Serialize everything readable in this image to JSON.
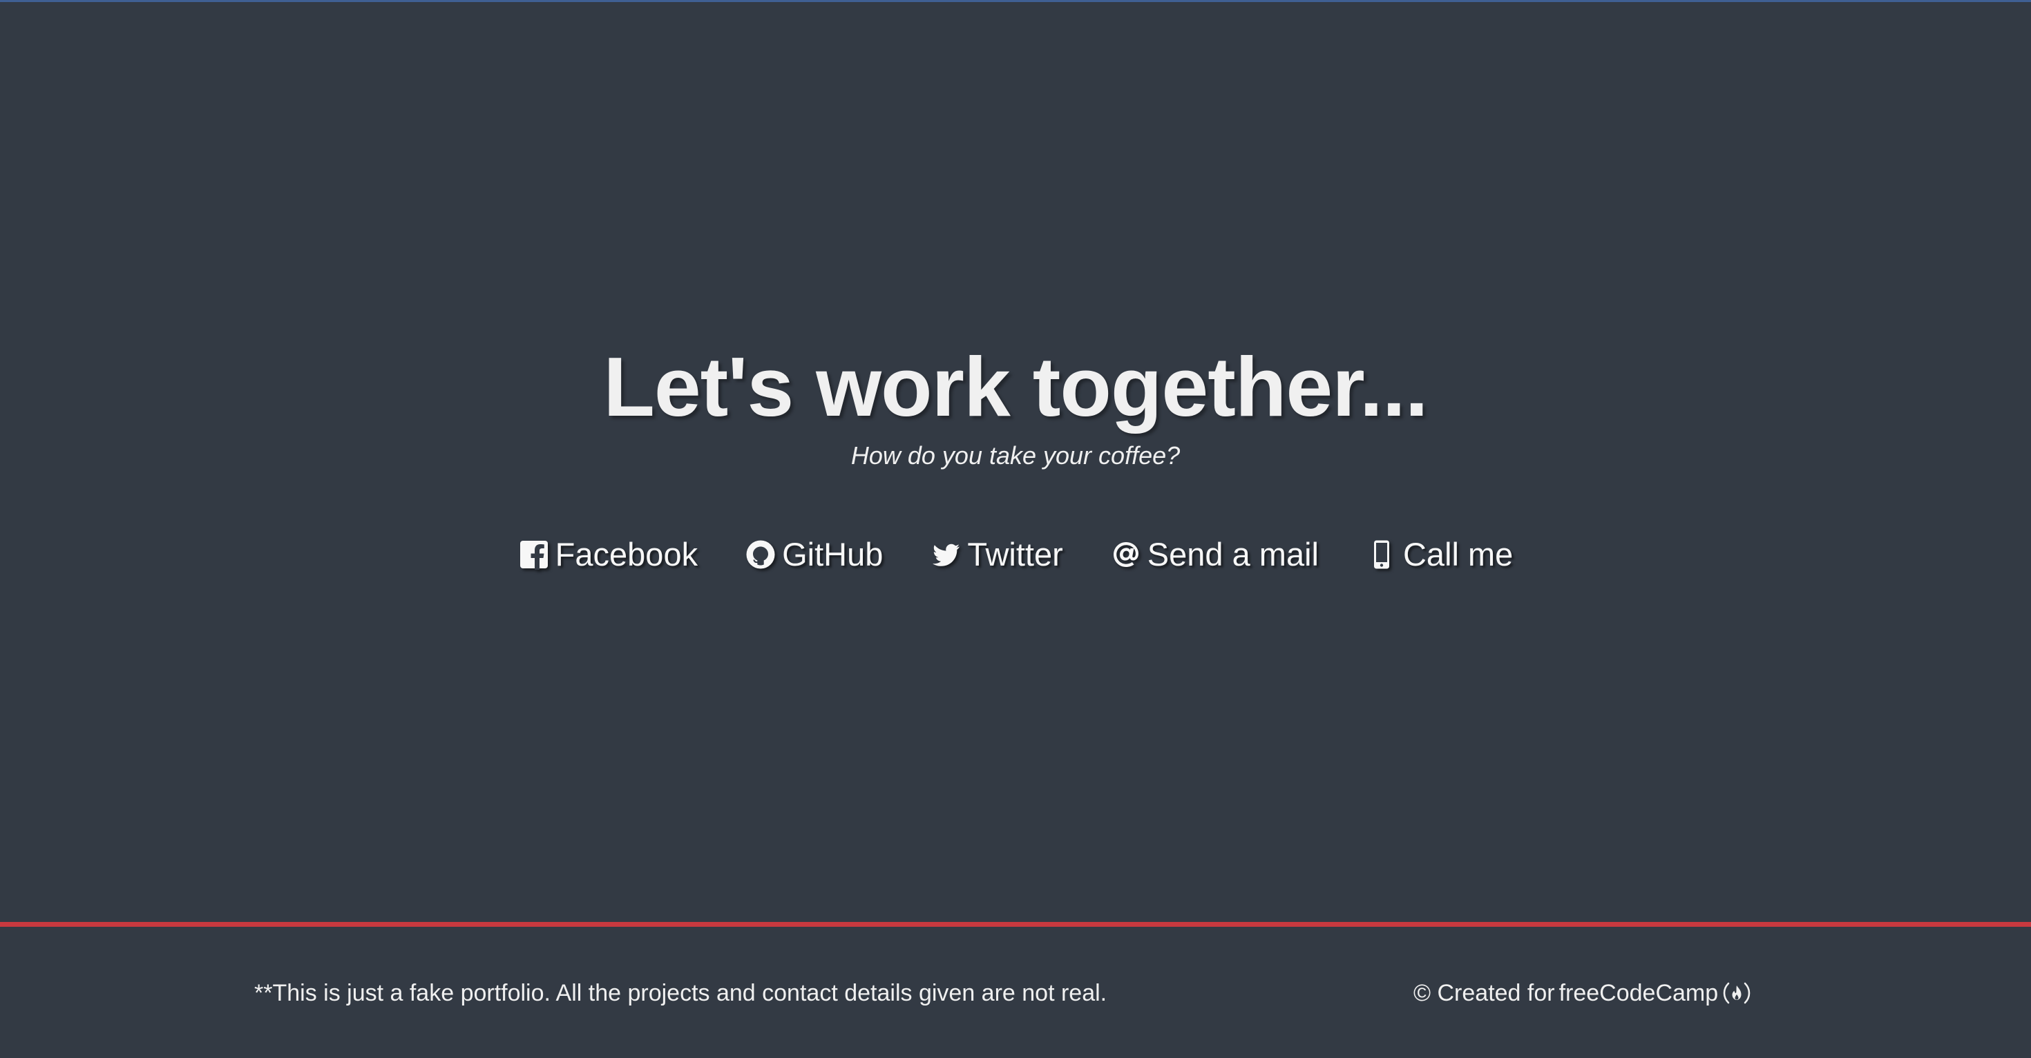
{
  "contact": {
    "title": "Let's work together...",
    "subtitle": "How do you take your coffee?",
    "links": [
      {
        "label": "Facebook",
        "icon": "facebook-square-icon"
      },
      {
        "label": "GitHub",
        "icon": "github-icon"
      },
      {
        "label": "Twitter",
        "icon": "twitter-icon"
      },
      {
        "label": "Send a mail",
        "icon": "at-icon"
      },
      {
        "label": "Call me",
        "icon": "mobile-phone-icon"
      }
    ]
  },
  "footer": {
    "note": "**This is just a fake portfolio. All the projects and contact details given are not real.",
    "copyright_prefix": "© Created for",
    "credit_link": "freeCodeCamp",
    "credit_icon": "freecodecamp-icon"
  },
  "colors": {
    "background": "#333a44",
    "text": "#f0f0f0",
    "divider": "#c8393f",
    "top_line": "#3f5f93"
  }
}
